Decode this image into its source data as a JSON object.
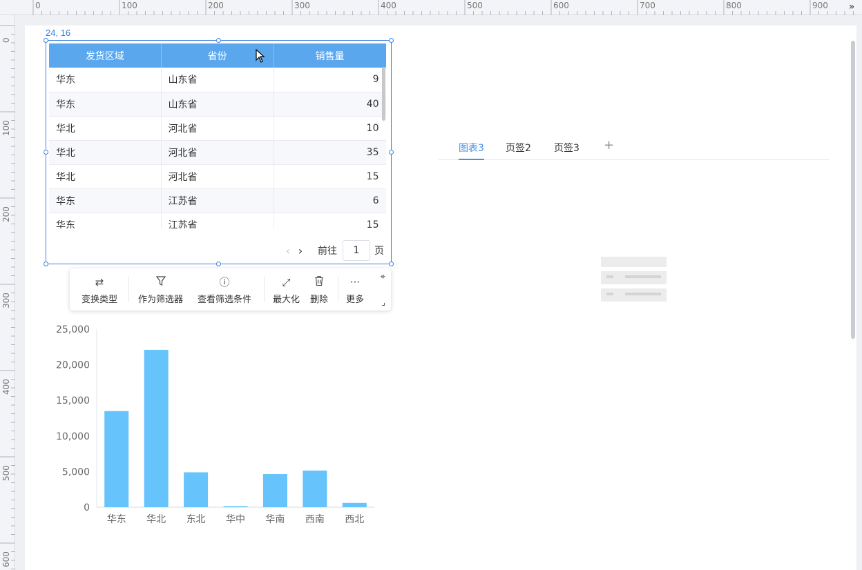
{
  "ruler": {
    "top_labels": [
      "0",
      "100",
      "200",
      "300",
      "400",
      "500",
      "600",
      "700",
      "800",
      "900"
    ],
    "left_labels": [
      "0",
      "100",
      "200",
      "300",
      "400",
      "500",
      "600"
    ],
    "corner_icon": "double-chevron-right-icon"
  },
  "selection": {
    "coord_label": "24, 16"
  },
  "table": {
    "headers": [
      "发货区域",
      "省份",
      "销售量"
    ],
    "rows": [
      [
        "华东",
        "山东省",
        "9"
      ],
      [
        "华东",
        "山东省",
        "40"
      ],
      [
        "华北",
        "河北省",
        "10"
      ],
      [
        "华北",
        "河北省",
        "35"
      ],
      [
        "华北",
        "河北省",
        "15"
      ],
      [
        "华东",
        "江苏省",
        "6"
      ],
      [
        "华东",
        "江苏省",
        "15"
      ]
    ]
  },
  "pager": {
    "goto_label": "前往",
    "page_value": "1",
    "page_unit": "页",
    "prev_icon": "chevron-left-icon",
    "next_icon": "chevron-right-icon"
  },
  "toolbar": {
    "change_type": "变换类型",
    "as_filter": "作为筛选器",
    "view_filter": "查看筛选条件",
    "maximize": "最大化",
    "delete": "删除",
    "more": "更多",
    "pin_icon": "pin-icon",
    "shrink_icon": "shrink-icon"
  },
  "tabs": {
    "items": [
      "图表3",
      "页签2",
      "页签3"
    ],
    "active": 0,
    "add_icon": "plus-icon"
  },
  "colors": {
    "accent": "#4a8fe7",
    "header_bg": "#5aa7ee",
    "bar": "#66c3fb",
    "selection": "#3d82e0"
  },
  "chart_data": {
    "type": "bar",
    "categories": [
      "华东",
      "华北",
      "东北",
      "华中",
      "华南",
      "西南",
      "西北"
    ],
    "values": [
      13500,
      22100,
      4900,
      150,
      4650,
      5150,
      600
    ],
    "ylim": [
      0,
      25000
    ],
    "yticks": [
      "0",
      "5,000",
      "10,000",
      "15,000",
      "20,000",
      "25,000"
    ],
    "ytick_values": [
      0,
      5000,
      10000,
      15000,
      20000,
      25000
    ],
    "title": "",
    "xlabel": "",
    "ylabel": "",
    "grid": false
  }
}
